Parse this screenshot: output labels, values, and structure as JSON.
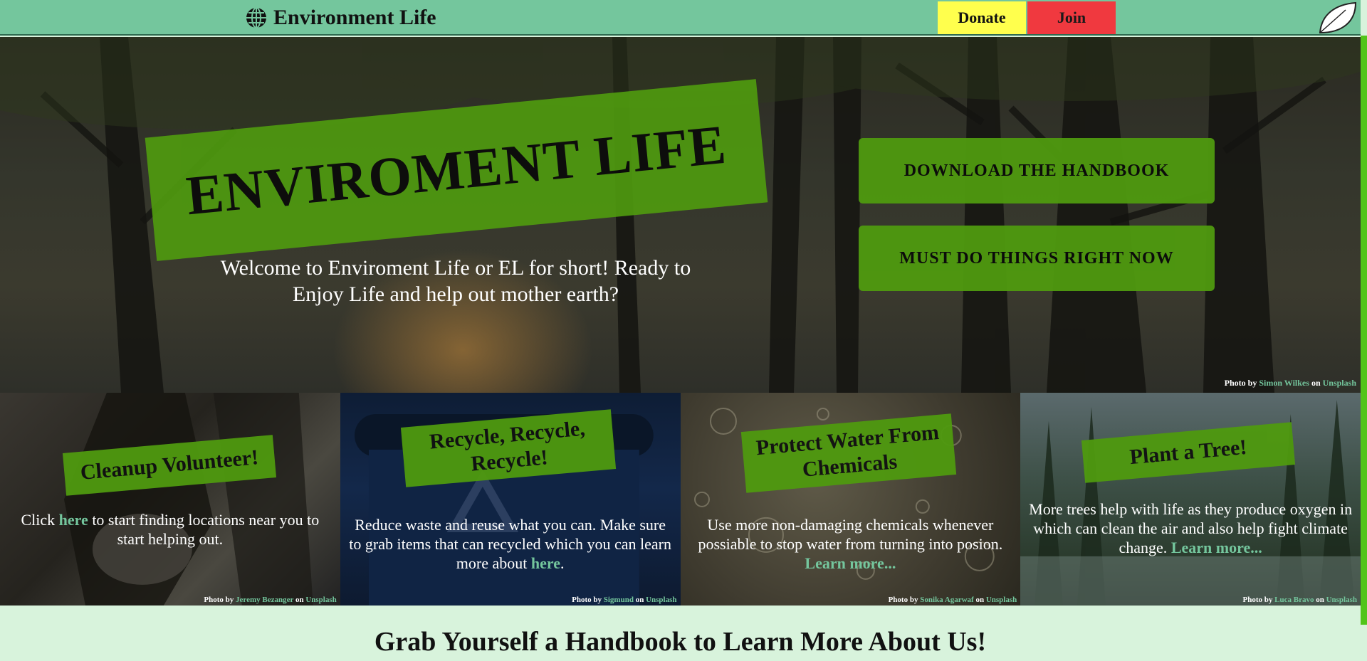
{
  "nav": {
    "brand": "Environment Life",
    "donate": "Donate",
    "join": "Join",
    "colors": {
      "bar": "#74c69d",
      "donate": "#ffff4d",
      "join": "#f0393f"
    }
  },
  "hero": {
    "banner": "ENVIROMENT LIFE",
    "welcome": "Welcome to Enviroment Life or EL for short! Ready to Enjoy Life and help out mother earth?",
    "cta_handbook": "DOWNLOAD THE HANDBOOK",
    "cta_now": "MUST DO THINGS RIGHT NOW",
    "credit": {
      "prefix": "Photo by",
      "author": "Simon Wilkes",
      "on": "on",
      "site": "Unsplash"
    }
  },
  "cards": [
    {
      "title": "Cleanup Volunteer!",
      "text_before": "Click",
      "link": "here",
      "text_after": "to start finding locations near you to start helping out.",
      "credit": {
        "prefix": "Photo by",
        "author": "Jeremy Bezanger",
        "on": "on",
        "site": "Unsplash"
      }
    },
    {
      "title": "Recycle, Recycle, Recycle!",
      "text_before": "Reduce waste and reuse what you can. Make sure to grab items that can recycled which you can learn more about",
      "link": "here",
      "text_after": ".",
      "credit": {
        "prefix": "Photo by",
        "author": "Sigmund",
        "on": "on",
        "site": "Unsplash"
      }
    },
    {
      "title": "Protect Water From Chemicals",
      "text_before": "Use more non-damaging chemicals whenever possiable to stop water from turning into posion.",
      "link": "Learn more...",
      "text_after": "",
      "credit": {
        "prefix": "Photo by",
        "author": "Sonika Agarwaf",
        "on": "on",
        "site": "Unsplash"
      }
    },
    {
      "title": "Plant a Tree!",
      "text_before": "More trees help with life as they produce oxygen in which can clean the air and also help fight climate change.",
      "link": "Learn more...",
      "text_after": "",
      "credit": {
        "prefix": "Photo by",
        "author": "Luca Bravo",
        "on": "on",
        "site": "Unsplash"
      }
    }
  ],
  "section": {
    "title": "Grab Yourself a Handbook to Learn More About Us!"
  },
  "accent_color": "#4f9a0f"
}
